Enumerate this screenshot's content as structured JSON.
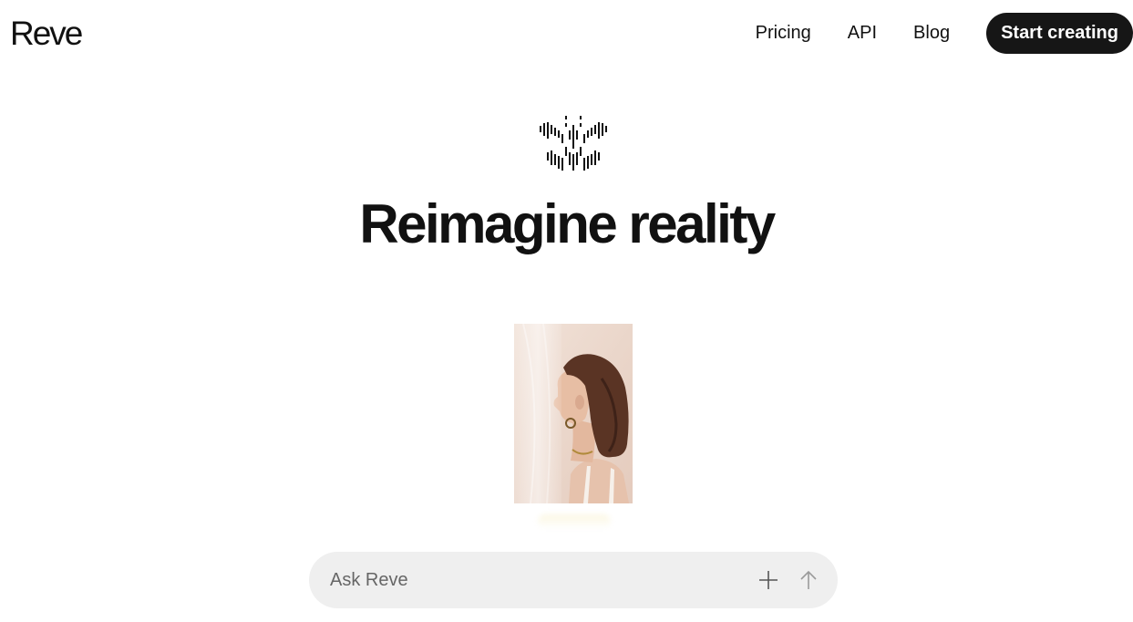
{
  "header": {
    "logo": "Reve",
    "nav": {
      "pricing": "Pricing",
      "api": "API",
      "blog": "Blog"
    },
    "cta": "Start creating"
  },
  "hero": {
    "mark_icon": "butterfly-barcode-icon",
    "title": "Reimagine reality",
    "image_icon": "portrait-photo"
  },
  "prompt": {
    "placeholder": "Ask Reve",
    "value": "",
    "add_icon": "plus-icon",
    "send_icon": "arrow-up-icon"
  },
  "colors": {
    "background": "#ffffff",
    "text": "#111111",
    "cta_background": "#161616",
    "cta_text": "#ffffff",
    "prompt_background": "#efefef",
    "placeholder": "#666666",
    "icon_muted": "#9a9a9a"
  }
}
